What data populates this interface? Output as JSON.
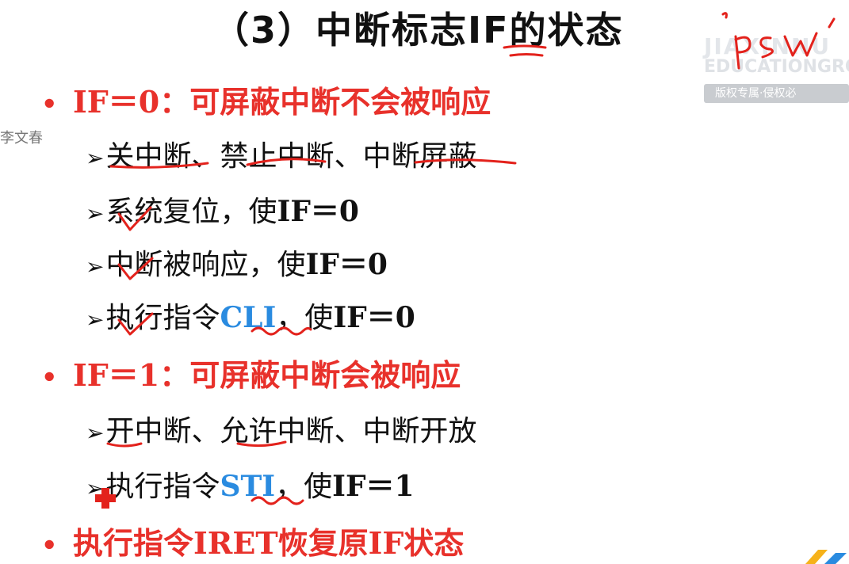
{
  "slide": {
    "title": "（3）中断标志IF的状态",
    "bullets": [
      {
        "text": "IF＝0：可屏蔽中断不会被响应"
      },
      {
        "text": "IF＝1：可屏蔽中断会被响应"
      },
      {
        "text": "执行指令IRET恢复原IF状态"
      }
    ],
    "sub_items": [
      {
        "text": "关中断、禁止中断、中断屏蔽"
      },
      {
        "cjk": "系统复位，使",
        "latin": "IF＝0"
      },
      {
        "cjk": "中断被响应，使",
        "latin": "IF＝0"
      },
      {
        "pre": "执行指令",
        "code": "CLI",
        "post": "，使",
        "latin": "IF＝0"
      },
      {
        "text": "开中断、允许中断、中断开放"
      },
      {
        "pre": "执行指令",
        "code": "STI",
        "post": "，使",
        "latin": "IF＝1"
      }
    ],
    "arrow_glyph": "➢",
    "bullet_glyph": "•"
  },
  "overlay": {
    "viewer_name": "李文春",
    "handwritten_note": "psw",
    "watermark": {
      "line1": "JIAXINNU",
      "line2": "EDUCATIONGRO",
      "badge": "版权专属·侵权必"
    }
  },
  "colors": {
    "title": "#111111",
    "bullet": "#e8312b",
    "code": "#2a8be0",
    "annotation": "#e3221c"
  }
}
